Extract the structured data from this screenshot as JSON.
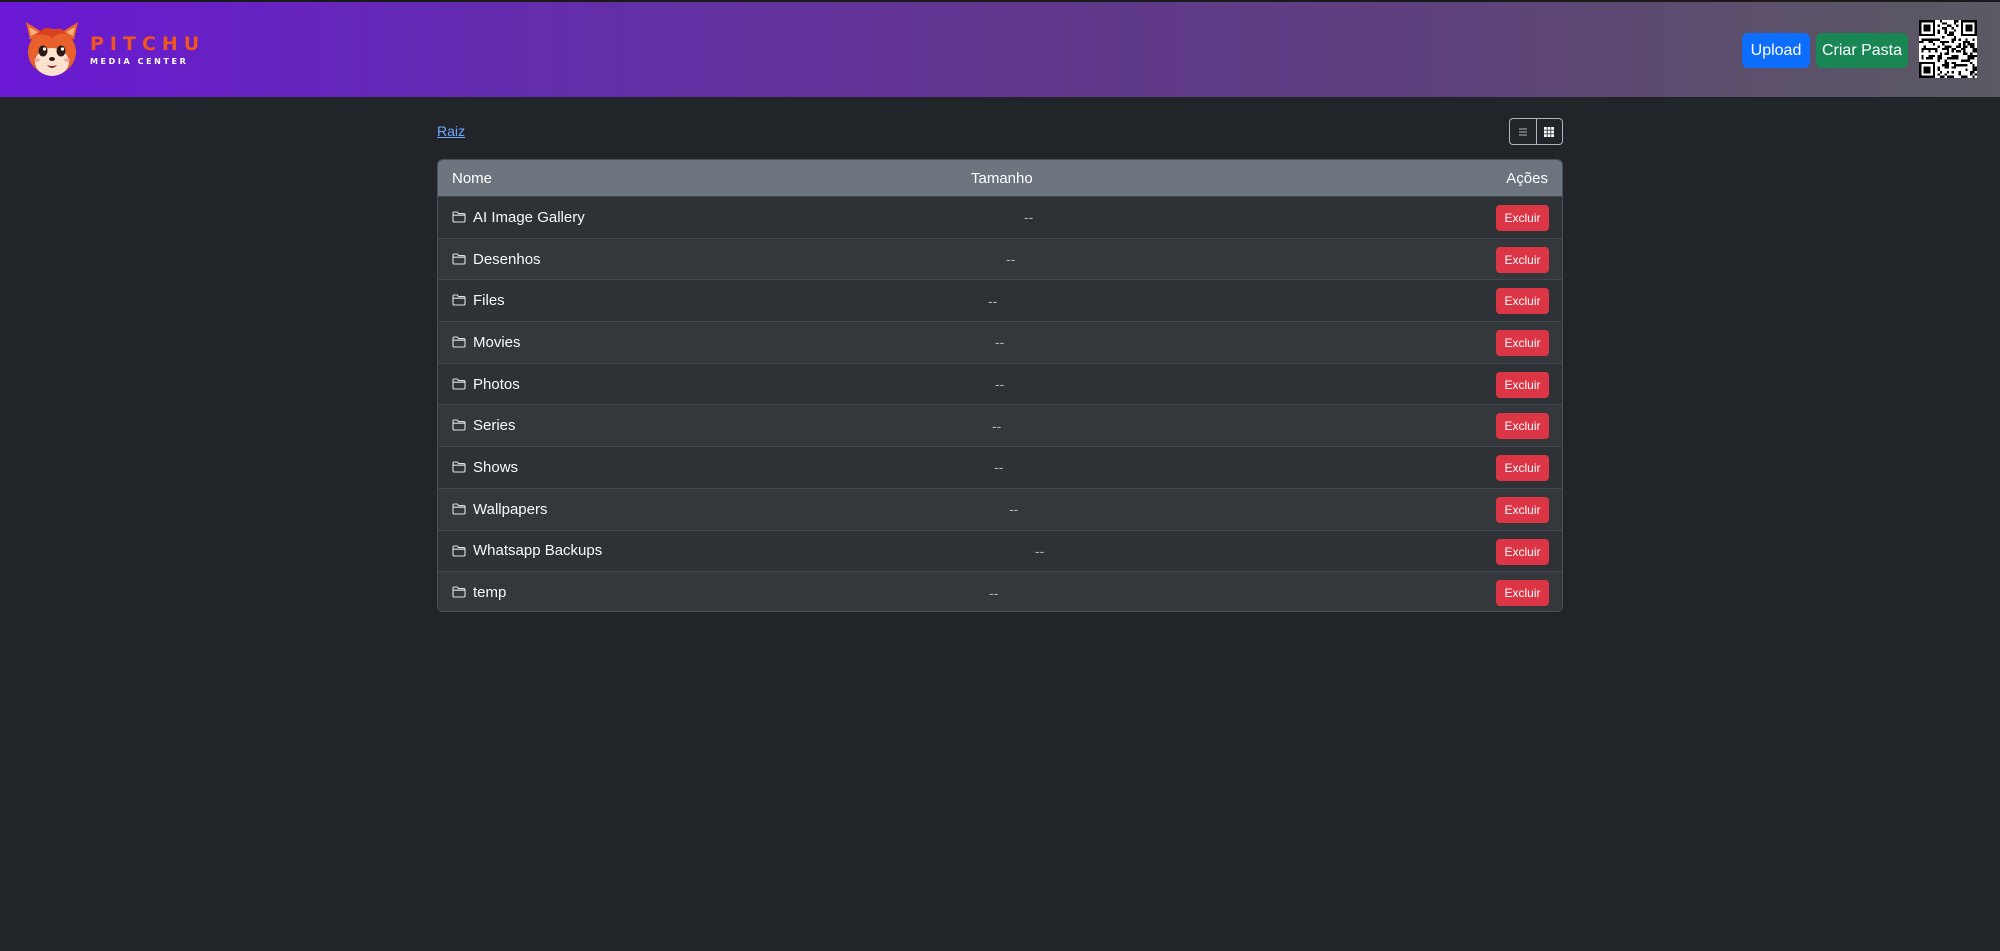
{
  "brand": {
    "title": "PITCHU",
    "subtitle": "MEDIA CENTER",
    "logo_icon": "fox-mascot-icon",
    "accent": "#f0541f"
  },
  "header": {
    "upload_label": "Upload",
    "create_folder_label": "Criar Pasta",
    "qr_icon": "qr-code-icon"
  },
  "breadcrumb": {
    "root_label": "Raiz"
  },
  "view_toggle": {
    "list_icon": "list-icon",
    "grid_icon": "grid-icon",
    "active": "grid"
  },
  "table": {
    "columns": {
      "name": "Nome",
      "size": "Tamanho",
      "actions": "Ações"
    },
    "delete_label": "Excluir",
    "rows": [
      {
        "name": "AI Image Gallery",
        "size": "--"
      },
      {
        "name": "Desenhos",
        "size": "--"
      },
      {
        "name": "Files",
        "size": "--"
      },
      {
        "name": "Movies",
        "size": "--"
      },
      {
        "name": "Photos",
        "size": "--"
      },
      {
        "name": "Series",
        "size": "--"
      },
      {
        "name": "Shows",
        "size": "--"
      },
      {
        "name": "Wallpapers",
        "size": "--"
      },
      {
        "name": "Whatsapp Backups",
        "size": "--"
      },
      {
        "name": "temp",
        "size": "--"
      }
    ]
  },
  "colors": {
    "background": "#212529",
    "primary": "#0d6efd",
    "success": "#198754",
    "danger": "#dc3545",
    "table_header": "#6c757d",
    "link": "#6ea8fe"
  }
}
